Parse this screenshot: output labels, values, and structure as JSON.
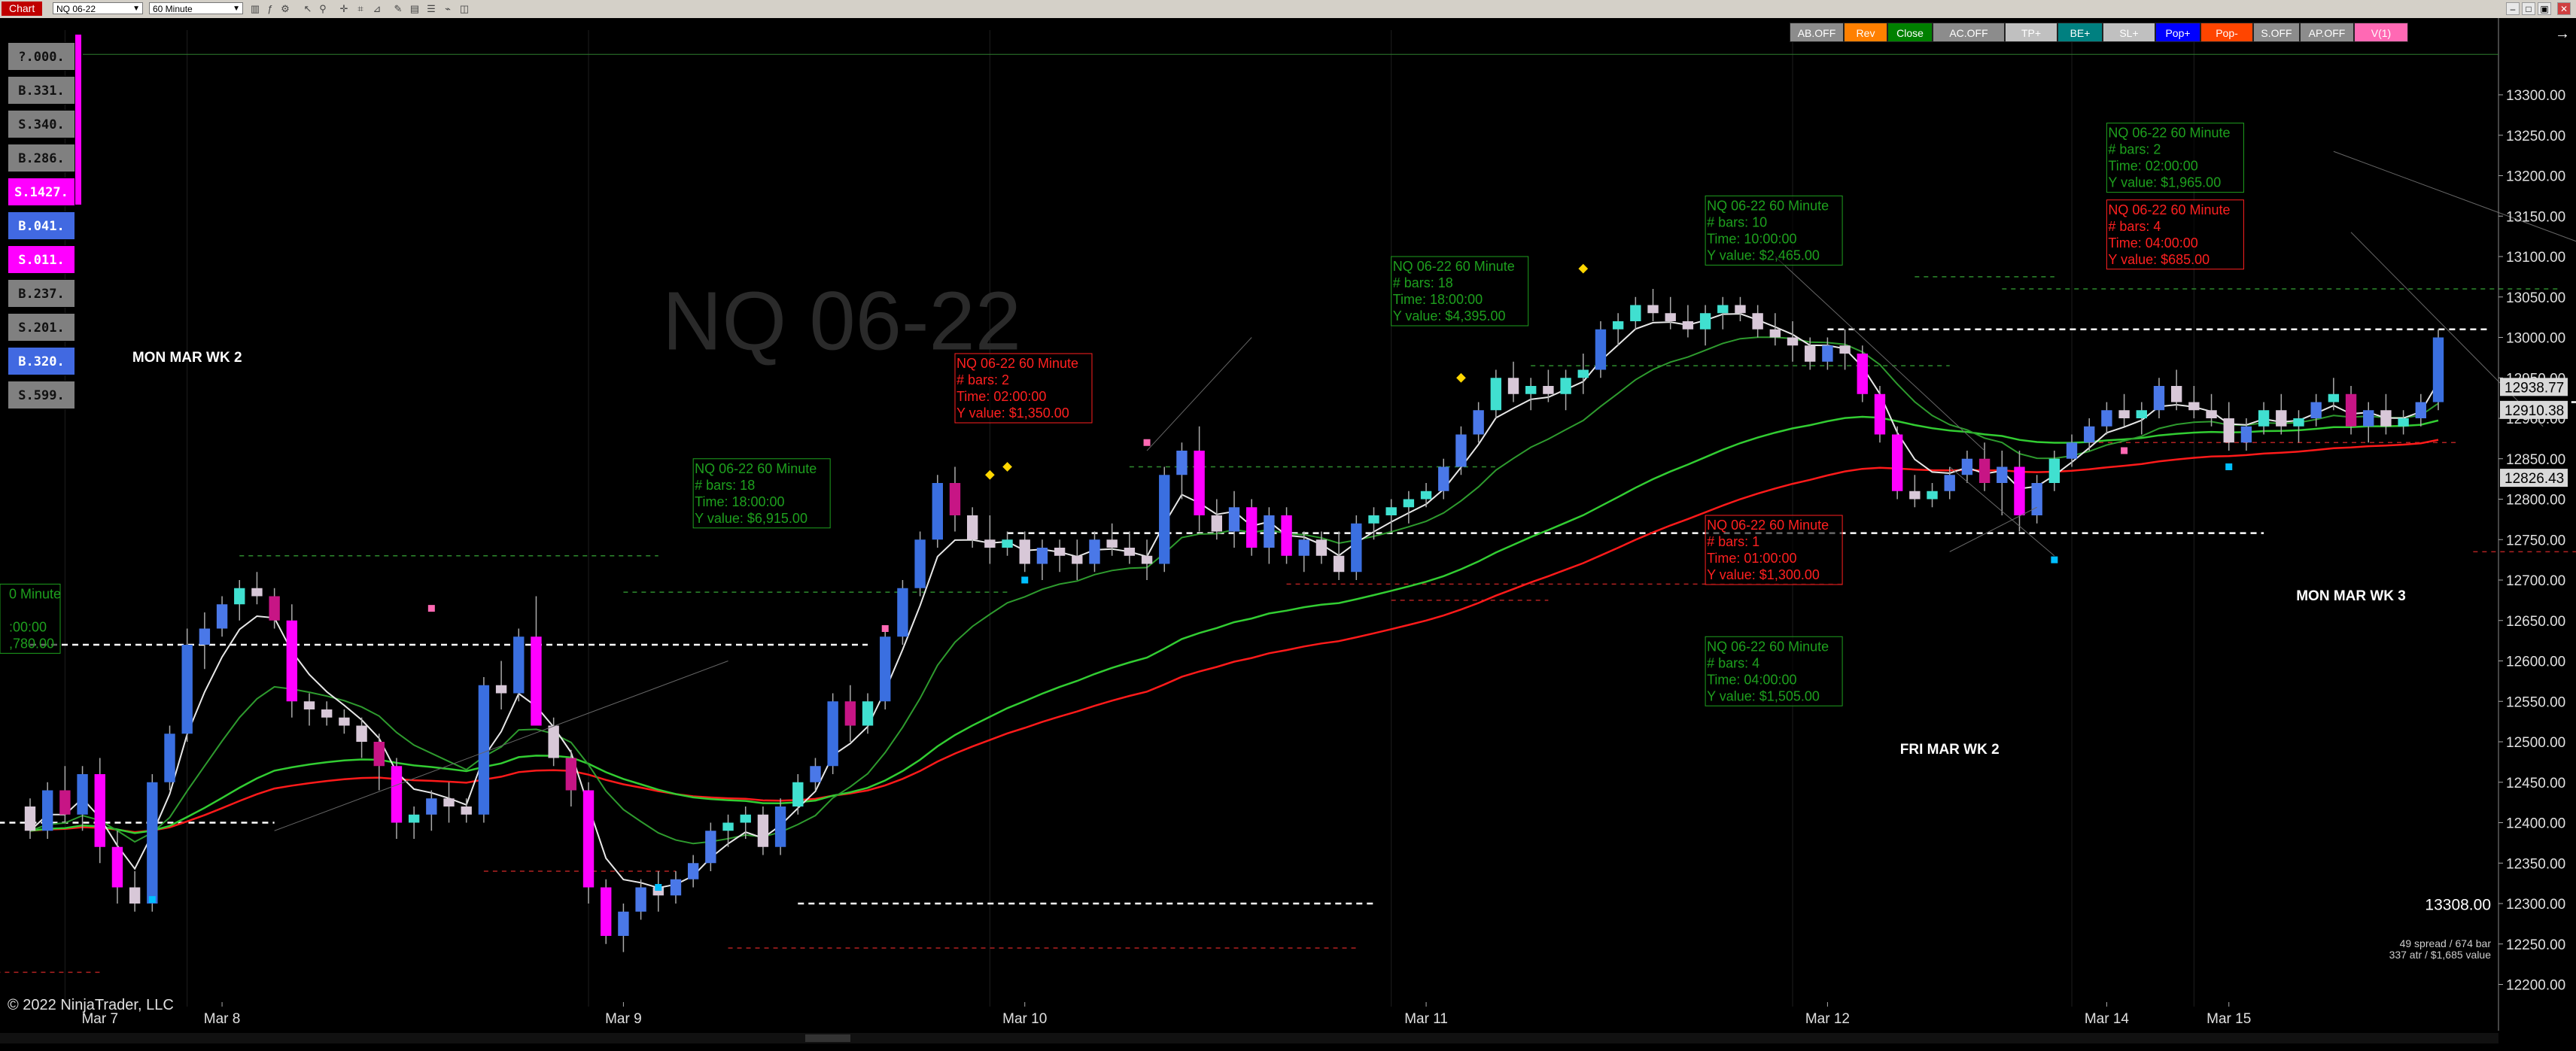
{
  "toolbar": {
    "chart_tab": "Chart",
    "instrument": "NQ 06-22",
    "interval": "60 Minute"
  },
  "watermark": "NQ 06-22",
  "copyright": "© 2022 NinjaTrader, LLC",
  "buttons": [
    {
      "label": "AB.OFF",
      "bg": "#8c8c8c",
      "fg": "#ffffff"
    },
    {
      "label": "Rev",
      "bg": "#ff8000",
      "fg": "#ffffff"
    },
    {
      "label": "Close",
      "bg": "#008000",
      "fg": "#ffffff"
    },
    {
      "label": "AC.OFF",
      "bg": "#8c8c8c",
      "fg": "#ffffff"
    },
    {
      "label": "TP+",
      "bg": "#c0c0c0",
      "fg": "#ffffff"
    },
    {
      "label": "BE+",
      "bg": "#008080",
      "fg": "#ffffff"
    },
    {
      "label": "SL+",
      "bg": "#c0c0c0",
      "fg": "#ffffff"
    },
    {
      "label": "Pop+",
      "bg": "#0000ff",
      "fg": "#ffffff"
    },
    {
      "label": "Pop-",
      "bg": "#ff4500",
      "fg": "#ffffff"
    },
    {
      "label": "S.OFF",
      "bg": "#8c8c8c",
      "fg": "#ffffff"
    },
    {
      "label": "AP.OFF",
      "bg": "#8c8c8c",
      "fg": "#ffffff"
    },
    {
      "label": "V(1)",
      "bg": "#ff69b4",
      "fg": "#ffffff"
    }
  ],
  "position_boxes": [
    {
      "label": "?.000.",
      "bg": "#808080"
    },
    {
      "label": "B.331.",
      "bg": "#808080"
    },
    {
      "label": "S.340.",
      "bg": "#808080"
    },
    {
      "label": "B.286.",
      "bg": "#808080"
    },
    {
      "label": "S.1427.",
      "bg": "#ff00ff"
    },
    {
      "label": "B.041.",
      "bg": "#4169e1"
    },
    {
      "label": "S.011.",
      "bg": "#ff00ff"
    },
    {
      "label": "B.237.",
      "bg": "#808080"
    },
    {
      "label": "S.201.",
      "bg": "#808080"
    },
    {
      "label": "B.320.",
      "bg": "#4169e1"
    },
    {
      "label": "S.599.",
      "bg": "#808080"
    }
  ],
  "chart_data": {
    "type": "candlestick",
    "instrument": "NQ 06-22",
    "interval": "60 Minute",
    "ylim": [
      12180,
      13380
    ],
    "y_ticks": [
      12200,
      12250,
      12300,
      12350,
      12400,
      12450,
      12500,
      12550,
      12600,
      12650,
      12700,
      12750,
      12800,
      12850,
      12900,
      12950,
      13000,
      13050,
      13100,
      13150,
      13200,
      13250,
      13300
    ],
    "x_labels": [
      {
        "label": "Mar 7",
        "bar": 4
      },
      {
        "label": "Mar 8",
        "bar": 11
      },
      {
        "label": "Mar 9",
        "bar": 34
      },
      {
        "label": "Mar 10",
        "bar": 57
      },
      {
        "label": "Mar 11",
        "bar": 80
      },
      {
        "label": "Mar 12",
        "bar": 103
      },
      {
        "label": "Mar 14",
        "bar": 119
      },
      {
        "label": "Mar 15",
        "bar": 126
      }
    ],
    "candles": [
      [
        12420,
        12430,
        12380,
        12390
      ],
      [
        12390,
        12450,
        12380,
        12440
      ],
      [
        12440,
        12470,
        12400,
        12410
      ],
      [
        12410,
        12470,
        12390,
        12460
      ],
      [
        12460,
        12480,
        12350,
        12370
      ],
      [
        12370,
        12390,
        12300,
        12320
      ],
      [
        12320,
        12340,
        12290,
        12300
      ],
      [
        12300,
        12460,
        12290,
        12450
      ],
      [
        12450,
        12520,
        12440,
        12510
      ],
      [
        12510,
        12640,
        12500,
        12620
      ],
      [
        12620,
        12660,
        12590,
        12640
      ],
      [
        12640,
        12680,
        12630,
        12670
      ],
      [
        12670,
        12700,
        12650,
        12690
      ],
      [
        12690,
        12710,
        12670,
        12680
      ],
      [
        12680,
        12690,
        12640,
        12650
      ],
      [
        12650,
        12670,
        12530,
        12550
      ],
      [
        12550,
        12560,
        12520,
        12540
      ],
      [
        12540,
        12550,
        12520,
        12530
      ],
      [
        12530,
        12540,
        12510,
        12520
      ],
      [
        12520,
        12530,
        12480,
        12500
      ],
      [
        12500,
        12510,
        12440,
        12470
      ],
      [
        12470,
        12480,
        12380,
        12400
      ],
      [
        12400,
        12420,
        12380,
        12410
      ],
      [
        12410,
        12440,
        12390,
        12430
      ],
      [
        12430,
        12450,
        12400,
        12420
      ],
      [
        12420,
        12430,
        12400,
        12410
      ],
      [
        12410,
        12580,
        12400,
        12570
      ],
      [
        12570,
        12600,
        12540,
        12560
      ],
      [
        12560,
        12640,
        12550,
        12630
      ],
      [
        12630,
        12680,
        12620,
        12520
      ],
      [
        12520,
        12530,
        12470,
        12480
      ],
      [
        12480,
        12490,
        12420,
        12440
      ],
      [
        12440,
        12450,
        12300,
        12320
      ],
      [
        12320,
        12330,
        12250,
        12260
      ],
      [
        12260,
        12300,
        12240,
        12290
      ],
      [
        12290,
        12330,
        12280,
        12320
      ],
      [
        12320,
        12340,
        12290,
        12310
      ],
      [
        12310,
        12340,
        12300,
        12330
      ],
      [
        12330,
        12360,
        12320,
        12350
      ],
      [
        12350,
        12400,
        12340,
        12390
      ],
      [
        12390,
        12410,
        12370,
        12400
      ],
      [
        12400,
        12420,
        12380,
        12410
      ],
      [
        12410,
        12420,
        12360,
        12370
      ],
      [
        12370,
        12430,
        12360,
        12420
      ],
      [
        12420,
        12460,
        12410,
        12450
      ],
      [
        12450,
        12480,
        12440,
        12470
      ],
      [
        12470,
        12560,
        12460,
        12550
      ],
      [
        12550,
        12570,
        12500,
        12520
      ],
      [
        12520,
        12560,
        12510,
        12550
      ],
      [
        12550,
        12640,
        12540,
        12630
      ],
      [
        12630,
        12700,
        12620,
        12690
      ],
      [
        12690,
        12760,
        12680,
        12750
      ],
      [
        12750,
        12830,
        12740,
        12820
      ],
      [
        12820,
        12840,
        12760,
        12780
      ],
      [
        12780,
        12790,
        12740,
        12750
      ],
      [
        12750,
        12780,
        12720,
        12740
      ],
      [
        12740,
        12760,
        12730,
        12750
      ],
      [
        12750,
        12760,
        12710,
        12720
      ],
      [
        12720,
        12750,
        12700,
        12740
      ],
      [
        12740,
        12750,
        12710,
        12730
      ],
      [
        12730,
        12750,
        12700,
        12720
      ],
      [
        12720,
        12760,
        12710,
        12750
      ],
      [
        12750,
        12770,
        12730,
        12740
      ],
      [
        12740,
        12760,
        12720,
        12730
      ],
      [
        12730,
        12750,
        12700,
        12720
      ],
      [
        12720,
        12840,
        12710,
        12830
      ],
      [
        12830,
        12870,
        12800,
        12860
      ],
      [
        12860,
        12890,
        12760,
        12780
      ],
      [
        12780,
        12800,
        12750,
        12760
      ],
      [
        12760,
        12810,
        12740,
        12790
      ],
      [
        12790,
        12800,
        12730,
        12740
      ],
      [
        12740,
        12790,
        12720,
        12780
      ],
      [
        12780,
        12790,
        12720,
        12730
      ],
      [
        12730,
        12760,
        12710,
        12750
      ],
      [
        12750,
        12760,
        12720,
        12730
      ],
      [
        12730,
        12760,
        12700,
        12710
      ],
      [
        12710,
        12780,
        12700,
        12770
      ],
      [
        12770,
        12790,
        12750,
        12780
      ],
      [
        12780,
        12800,
        12760,
        12790
      ],
      [
        12790,
        12810,
        12770,
        12800
      ],
      [
        12800,
        12820,
        12790,
        12810
      ],
      [
        12810,
        12850,
        12800,
        12840
      ],
      [
        12840,
        12890,
        12830,
        12880
      ],
      [
        12880,
        12920,
        12870,
        12910
      ],
      [
        12910,
        12960,
        12900,
        12950
      ],
      [
        12950,
        12970,
        12920,
        12930
      ],
      [
        12930,
        12950,
        12910,
        12940
      ],
      [
        12940,
        12960,
        12920,
        12930
      ],
      [
        12930,
        12960,
        12910,
        12950
      ],
      [
        12950,
        12980,
        12930,
        12960
      ],
      [
        12960,
        13020,
        12950,
        13010
      ],
      [
        13010,
        13030,
        12990,
        13020
      ],
      [
        13020,
        13050,
        13010,
        13040
      ],
      [
        13040,
        13060,
        13020,
        13030
      ],
      [
        13030,
        13050,
        13010,
        13020
      ],
      [
        13020,
        13040,
        13000,
        13010
      ],
      [
        13010,
        13040,
        12990,
        13030
      ],
      [
        13030,
        13050,
        13010,
        13040
      ],
      [
        13040,
        13050,
        13020,
        13030
      ],
      [
        13030,
        13040,
        13000,
        13010
      ],
      [
        13010,
        13030,
        12990,
        13000
      ],
      [
        13000,
        13020,
        12970,
        12990
      ],
      [
        12990,
        13000,
        12960,
        12970
      ],
      [
        12970,
        13000,
        12960,
        12990
      ],
      [
        12990,
        13010,
        12960,
        12980
      ],
      [
        12980,
        12990,
        12920,
        12930
      ],
      [
        12930,
        12940,
        12870,
        12880
      ],
      [
        12880,
        12890,
        12800,
        12810
      ],
      [
        12810,
        12830,
        12790,
        12800
      ],
      [
        12800,
        12820,
        12790,
        12810
      ],
      [
        12810,
        12840,
        12800,
        12830
      ],
      [
        12830,
        12860,
        12820,
        12850
      ],
      [
        12850,
        12870,
        12810,
        12820
      ],
      [
        12820,
        12860,
        12780,
        12840
      ],
      [
        12840,
        12860,
        12760,
        12780
      ],
      [
        12780,
        12830,
        12770,
        12820
      ],
      [
        12820,
        12860,
        12810,
        12850
      ],
      [
        12850,
        12880,
        12840,
        12870
      ],
      [
        12870,
        12900,
        12860,
        12890
      ],
      [
        12890,
        12920,
        12880,
        12910
      ],
      [
        12910,
        12930,
        12890,
        12900
      ],
      [
        12900,
        12920,
        12880,
        12910
      ],
      [
        12910,
        12950,
        12900,
        12940
      ],
      [
        12940,
        12960,
        12910,
        12920
      ],
      [
        12920,
        12940,
        12900,
        12910
      ],
      [
        12910,
        12930,
        12890,
        12900
      ],
      [
        12900,
        12920,
        12860,
        12870
      ],
      [
        12870,
        12900,
        12860,
        12890
      ],
      [
        12890,
        12920,
        12880,
        12910
      ],
      [
        12910,
        12930,
        12880,
        12890
      ],
      [
        12890,
        12910,
        12870,
        12900
      ],
      [
        12900,
        12930,
        12890,
        12920
      ],
      [
        12920,
        12950,
        12910,
        12930
      ],
      [
        12930,
        12940,
        12880,
        12890
      ],
      [
        12890,
        12920,
        12870,
        12910
      ],
      [
        12910,
        12930,
        12880,
        12890
      ],
      [
        12890,
        12910,
        12880,
        12900
      ],
      [
        12900,
        12930,
        12890,
        12920
      ],
      [
        12920,
        13010,
        12910,
        13000
      ]
    ],
    "labels": [
      {
        "text": "MON MAR WK 2",
        "bar": 9,
        "y": 12970
      },
      {
        "text": "FRI MAR WK 2",
        "bar": 110,
        "y": 12485
      },
      {
        "text": "MON MAR WK 3",
        "bar": 133,
        "y": 12675
      }
    ],
    "annotations": [
      {
        "color": "green",
        "bar": 38,
        "y": 12850,
        "lines": [
          "NQ 06-22 60 Minute",
          "# bars:   18",
          "Time:     18:00:00",
          "Y value:  $6,915.00"
        ]
      },
      {
        "color": "red",
        "bar": 53,
        "y": 12980,
        "lines": [
          "NQ 06-22 60 Minute",
          "# bars:   2",
          "Time:     02:00:00",
          "Y value:  $1,350.00"
        ]
      },
      {
        "color": "green",
        "bar": 78,
        "y": 13100,
        "lines": [
          "NQ 06-22 60 Minute",
          "# bars:   18",
          "Time:     18:00:00",
          "Y value:  $4,395.00"
        ]
      },
      {
        "color": "green",
        "bar": 96,
        "y": 13175,
        "lines": [
          "NQ 06-22 60 Minute",
          "# bars:   10",
          "Time:     10:00:00",
          "Y value:  $2,465.00"
        ]
      },
      {
        "color": "red",
        "bar": 96,
        "y": 12780,
        "lines": [
          "NQ 06-22 60 Minute",
          "# bars:   1",
          "Time:     01:00:00",
          "Y value:  $1,300.00"
        ]
      },
      {
        "color": "green",
        "bar": 96,
        "y": 12630,
        "lines": [
          "NQ 06-22 60 Minute",
          "# bars:   4",
          "Time:     04:00:00",
          "Y value:  $1,505.00"
        ]
      },
      {
        "color": "green",
        "bar": 119,
        "y": 13265,
        "lines": [
          "NQ 06-22 60 Minute",
          "# bars:   2",
          "Time:     02:00:00",
          "Y value:  $1,965.00"
        ]
      },
      {
        "color": "red",
        "bar": 119,
        "y": 13170,
        "lines": [
          "NQ 06-22 60 Minute",
          "# bars:   4",
          "Time:     04:00:00",
          "Y value:  $685.00"
        ]
      },
      {
        "color": "green",
        "bar": 0,
        "y": 12695,
        "lines": [
          "0 Minute",
          "",
          ":00:00",
          ",780.00"
        ]
      }
    ],
    "price_markers": [
      {
        "label": "12938.77",
        "y": 12938.77
      },
      {
        "label": "12910.38",
        "y": 12910.38
      },
      {
        "label": "12826.43",
        "y": 12826.43
      }
    ],
    "last_price": "13308.00",
    "stats_line1": "49 spread / 674 bar",
    "stats_line2": "337 atr / $1,685 value"
  }
}
